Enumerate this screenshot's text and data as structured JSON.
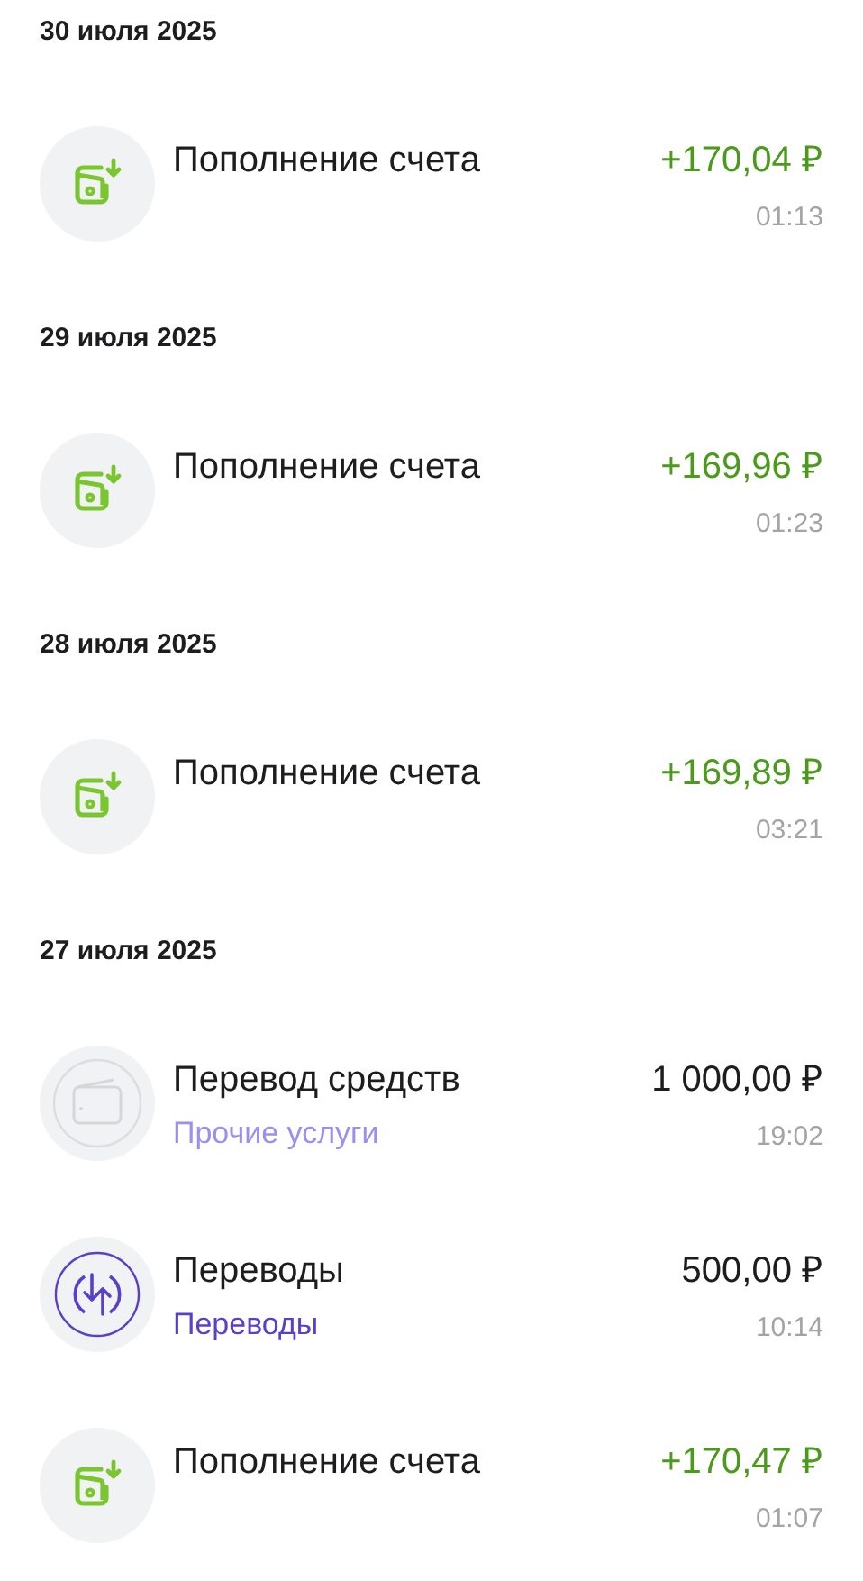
{
  "groups": [
    {
      "date": "30 июля 2025",
      "items": [
        {
          "kind": "topup",
          "title": "Пополнение счета",
          "amount": "+170,04 ₽",
          "incoming": true,
          "time": "01:13"
        }
      ]
    },
    {
      "date": "29 июля 2025",
      "items": [
        {
          "kind": "topup",
          "title": "Пополнение счета",
          "amount": "+169,96 ₽",
          "incoming": true,
          "time": "01:23"
        }
      ]
    },
    {
      "date": "28 июля 2025",
      "items": [
        {
          "kind": "topup",
          "title": "Пополнение счета",
          "amount": "+169,89 ₽",
          "incoming": true,
          "time": "03:21"
        }
      ]
    },
    {
      "date": "27 июля 2025",
      "items": [
        {
          "kind": "card",
          "title": "Перевод средств",
          "subtitle": "Прочие услуги",
          "color": "#9a90f0",
          "amount": "1 000,00 ₽",
          "incoming": false,
          "time": "19:02"
        },
        {
          "kind": "transfer",
          "title": "Переводы",
          "subtitle": "Переводы",
          "color": "#5a3fc8",
          "amount": "500,00 ₽",
          "incoming": false,
          "time": "10:14"
        },
        {
          "kind": "topup",
          "title": "Пополнение счета",
          "amount": "+170,47 ₽",
          "incoming": true,
          "time": "01:07"
        }
      ]
    }
  ]
}
